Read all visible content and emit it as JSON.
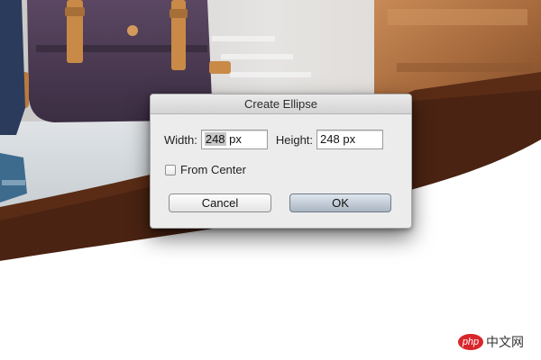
{
  "dialog": {
    "title": "Create Ellipse",
    "width_label": "Width:",
    "width_value": "248 px",
    "width_value_number": "248",
    "width_value_unit": " px",
    "height_label": "Height:",
    "height_value": "248 px",
    "from_center_label": "From Center",
    "from_center_checked": false,
    "cancel_label": "Cancel",
    "ok_label": "OK"
  },
  "watermark": {
    "logo_text": "php",
    "site_text": "中文网"
  },
  "colors": {
    "brown_wave": "#4a2312",
    "wood": "#b87a48",
    "bag": "#4b3a52",
    "strap": "#c98a47",
    "ok_button": "#b4bfcb"
  }
}
